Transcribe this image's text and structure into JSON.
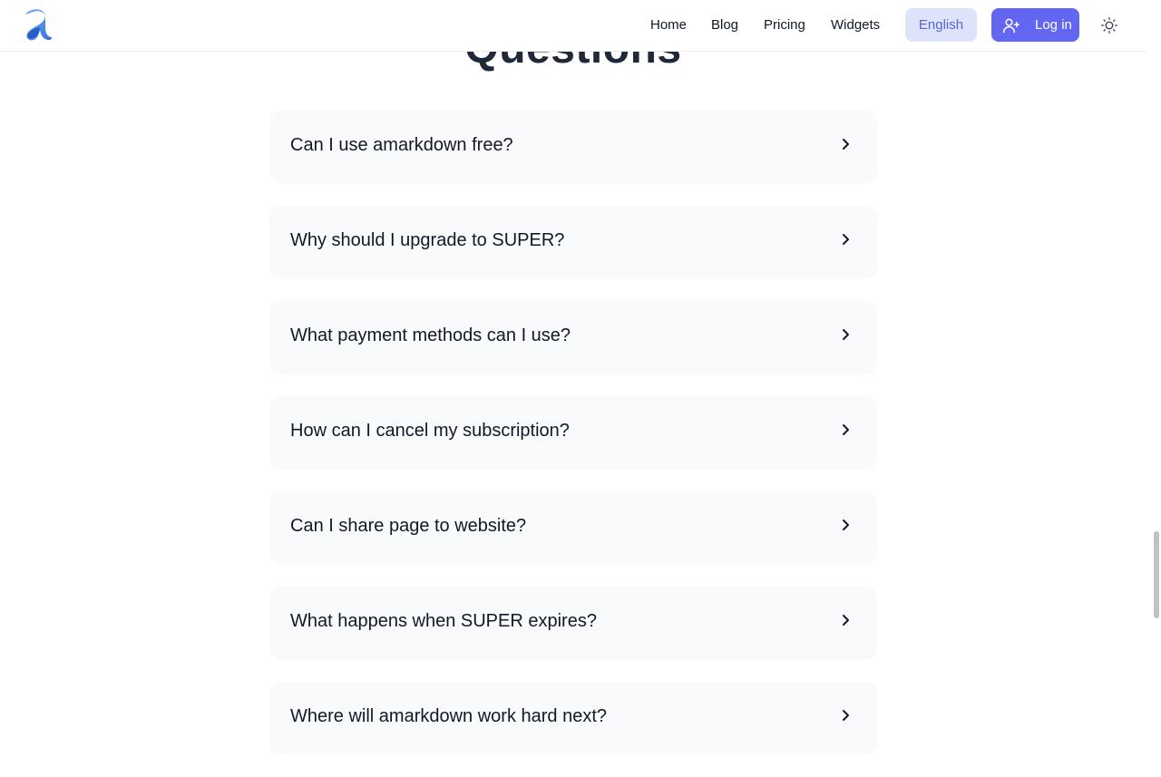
{
  "section": {
    "heading": "Questions"
  },
  "header": {
    "logo_icon": "amarkdown-logo-icon",
    "nav": [
      {
        "label": "Home"
      },
      {
        "label": "Blog"
      },
      {
        "label": "Pricing"
      },
      {
        "label": "Widgets"
      }
    ],
    "language_label": "English",
    "login_label": "Log in",
    "login_icon": "user-plus-icon",
    "theme_icon": "sun-icon"
  },
  "faq": [
    {
      "question": "Can I use amarkdown free?"
    },
    {
      "question": "Why should I upgrade to SUPER?"
    },
    {
      "question": "What payment methods can I use?"
    },
    {
      "question": "How can I cancel my subscription?"
    },
    {
      "question": "Can I share page to website?"
    },
    {
      "question": "What happens when SUPER expires?"
    },
    {
      "question": "Where will amarkdown work hard next?"
    }
  ],
  "colors": {
    "accent": "#6366f1",
    "language_bg": "#dde3fb",
    "card_bg": "#f9fafb"
  }
}
